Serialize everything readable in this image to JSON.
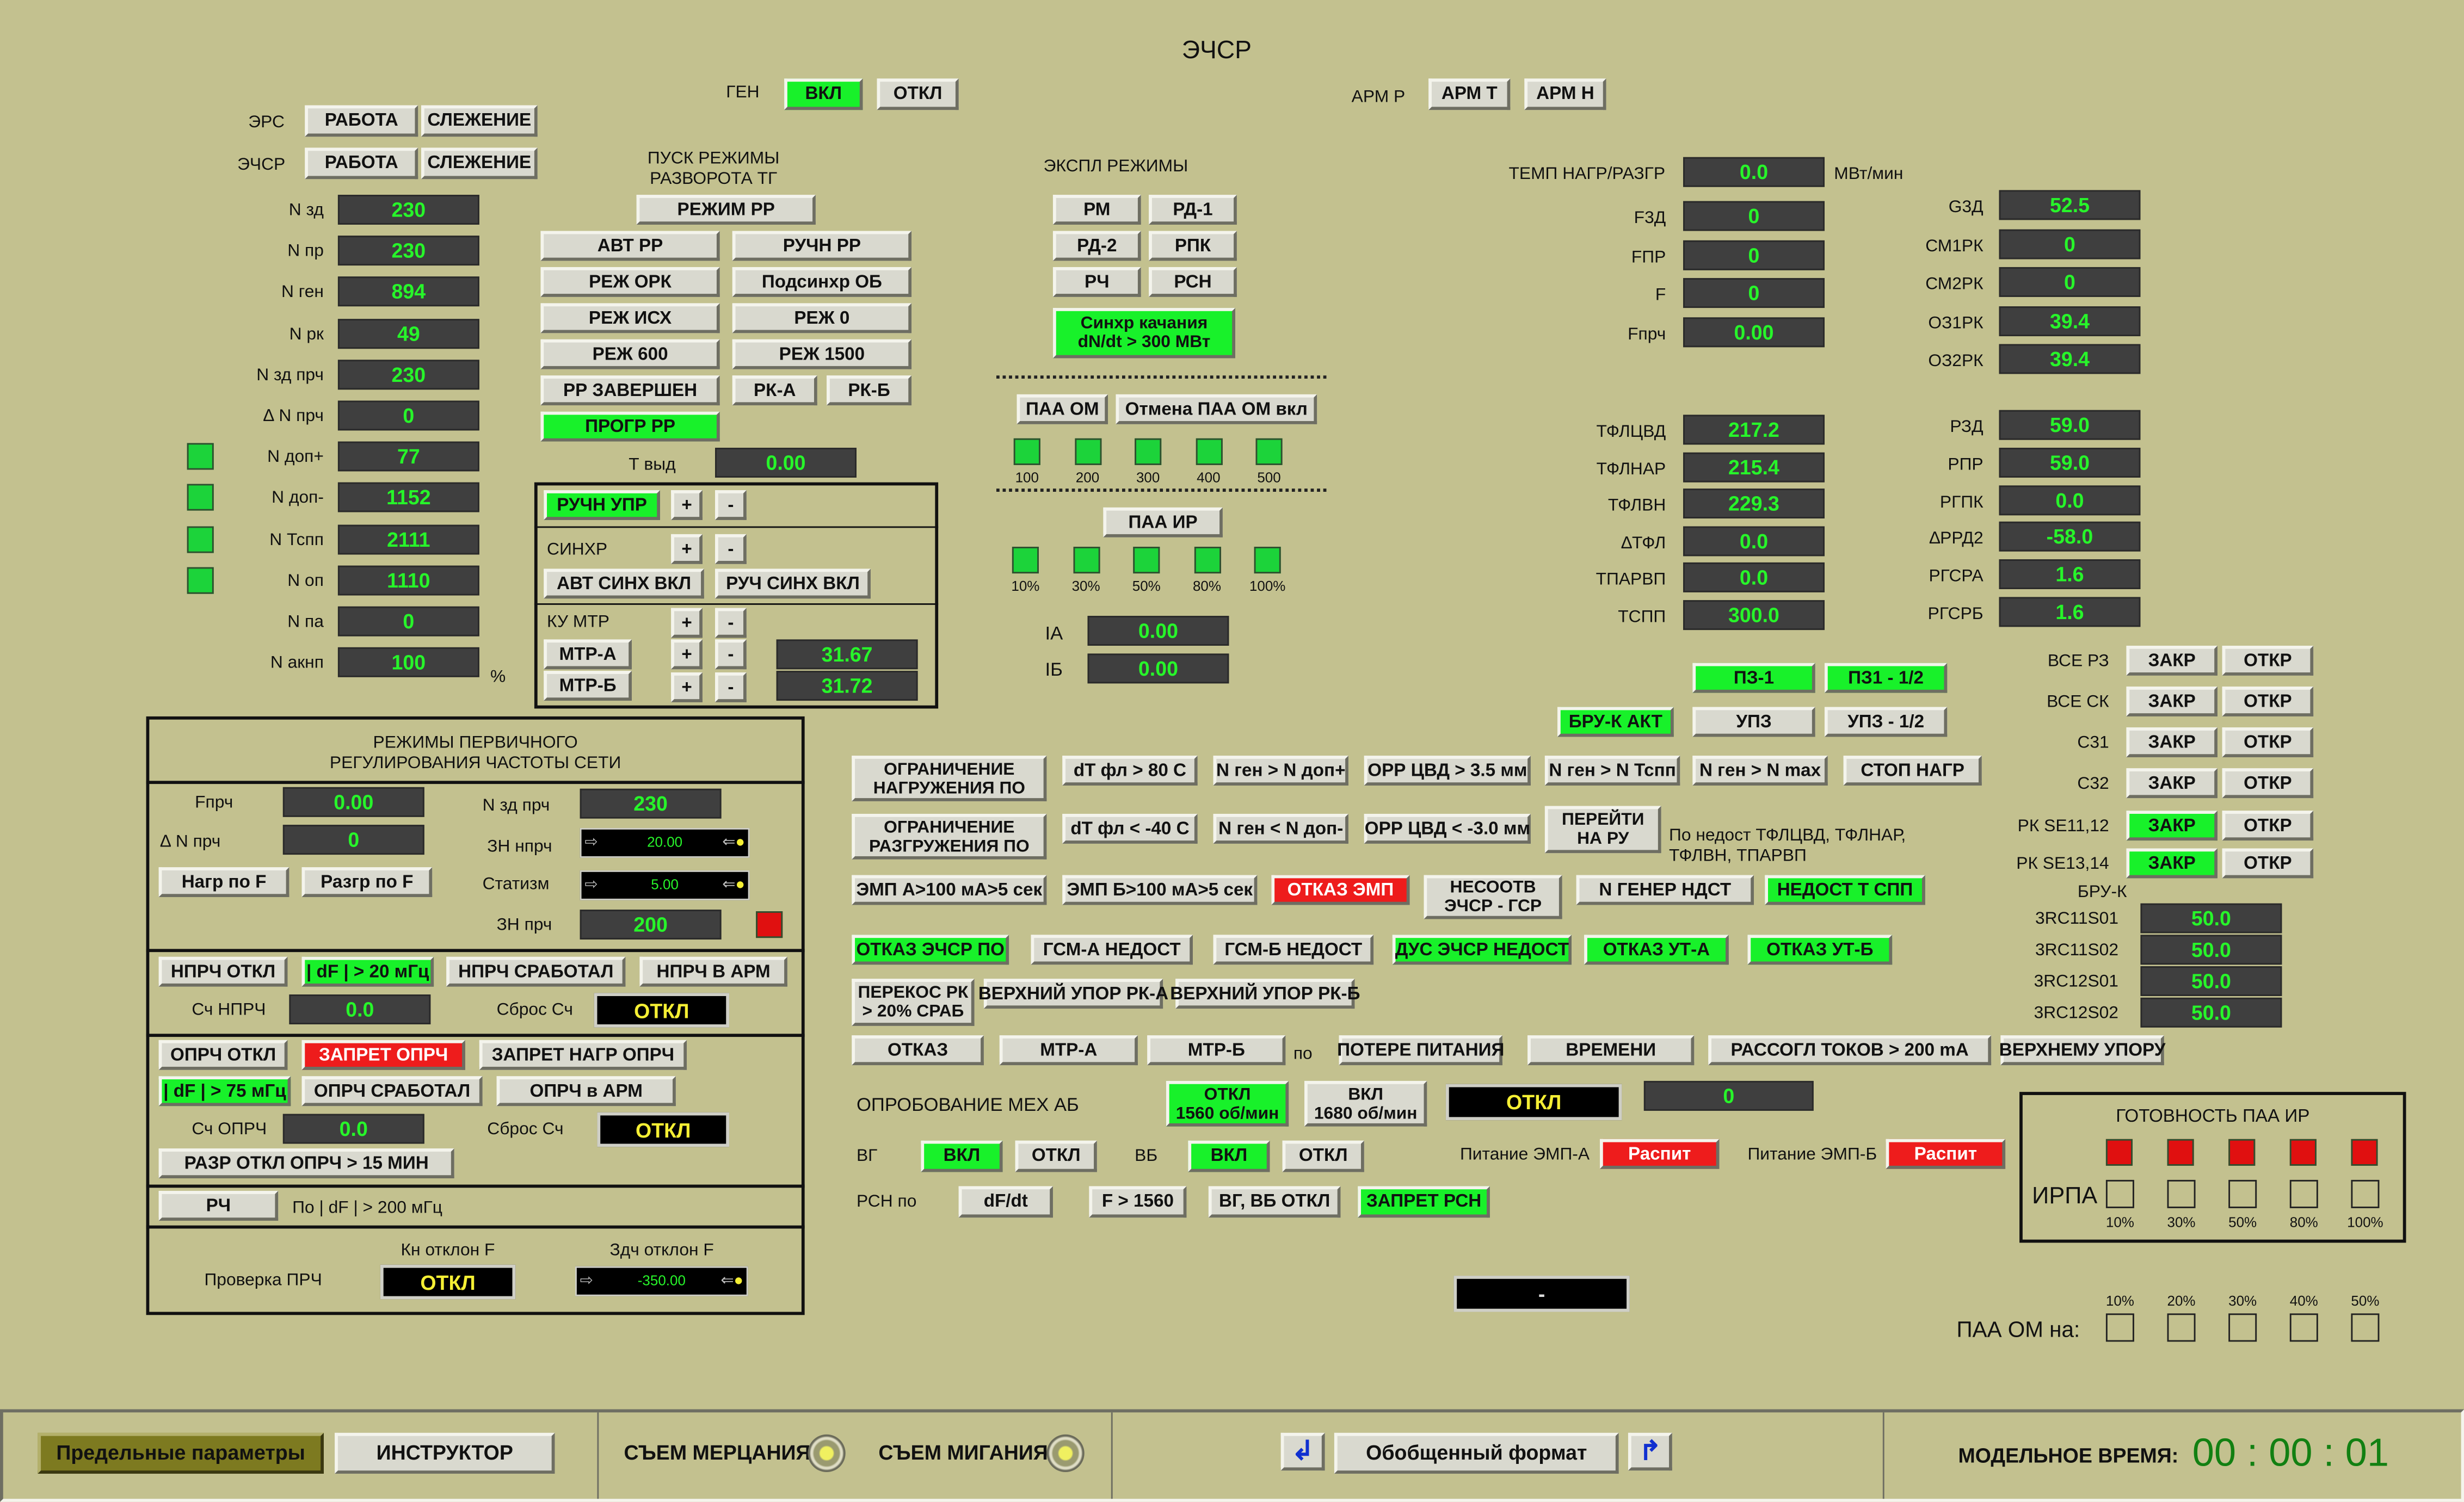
{
  "title": "ЭЧСР",
  "gen": {
    "label": "ГЕН",
    "on": "ВКЛ",
    "off": "ОТКЛ"
  },
  "arm": {
    "label": "АРМ Р",
    "t": "АРМ Т",
    "n": "АРМ Н"
  },
  "ers": {
    "label": "ЭРС",
    "work": "РАБОТА",
    "track": "СЛЕЖЕНИЕ"
  },
  "echsr": {
    "label": "ЭЧСР",
    "work": "РАБОТА",
    "track": "СЛЕЖЕНИЕ"
  },
  "params": [
    {
      "label": "N зд",
      "value": "230",
      "indicator": false
    },
    {
      "label": "N пр",
      "value": "230",
      "indicator": false
    },
    {
      "label": "N ген",
      "value": "894",
      "indicator": false
    },
    {
      "label": "N рк",
      "value": "49",
      "indicator": false
    },
    {
      "label": "N зд прч",
      "value": "230",
      "indicator": false
    },
    {
      "label": "∆ N прч",
      "value": "0",
      "indicator": false
    },
    {
      "label": "N доп+",
      "value": "77",
      "indicator": true
    },
    {
      "label": "N доп-",
      "value": "1152",
      "indicator": true
    },
    {
      "label": "N Тспп",
      "value": "2111",
      "indicator": true
    },
    {
      "label": "N оп",
      "value": "1110",
      "indicator": true
    },
    {
      "label": "N па",
      "value": "0",
      "indicator": false
    },
    {
      "label": "N акнп",
      "value": "100",
      "indicator": false
    }
  ],
  "percent": "%",
  "startup": {
    "title1": "ПУСК РЕЖИМЫ",
    "title2": "РАЗВОРОТА ТГ",
    "mode_rr": "РЕЖИМ РР",
    "avt_rr": "АВТ РР",
    "ruchn_rr": "РУЧН РР",
    "rezh_ork": "РЕЖ ОРК",
    "podsinhr": "Подсинхр ОБ",
    "rezh_ish": "РЕЖ ИСХ",
    "rezh0": "РЕЖ 0",
    "rezh600": "РЕЖ 600",
    "rezh1500": "РЕЖ 1500",
    "rr_done": "РР ЗАВЕРШЕН",
    "rka": "РК-А",
    "rkb": "РК-Б",
    "progr": "ПРОГР РР",
    "tvyd_label": "Т выд",
    "tvyd_value": "0.00"
  },
  "manual": {
    "ruchn": "РУЧН УПР",
    "plus": "+",
    "minus": "-",
    "sinhr": "СИНХР",
    "avt_sinh": "АВТ СИНХ ВКЛ",
    "ruch_sinh": "РУЧ СИНХ ВКЛ",
    "ku": "КУ МТР",
    "mtra": "МТР-А",
    "mtrb": "МТР-Б",
    "mtra_val": "31.67",
    "mtrb_val": "31.72"
  },
  "expl": {
    "title": "ЭКСПЛ РЕЖИМЫ",
    "rm": "РМ",
    "rd1": "РД-1",
    "rd2": "РД-2",
    "rpk": "РПК",
    "rch": "РЧ",
    "rsn": "РСН",
    "sinhr_kach1": "Синхр качания",
    "sinhr_kach2": "dN/dt > 300 МВт",
    "paa_om": "ПАА ОМ",
    "paa_cancel": "Отмена ПАА ОМ вкл",
    "om_levels": [
      "100",
      "200",
      "300",
      "400",
      "500"
    ],
    "paa_ir": "ПАА ИР",
    "ir_levels": [
      "10%",
      "30%",
      "50%",
      "80%",
      "100%"
    ],
    "ia": "IA",
    "ia_val": "0.00",
    "ib": "IБ",
    "ib_val": "0.00"
  },
  "temp": {
    "label": "ТЕМП НАГР/РАЗГР",
    "value": "0.0",
    "unit": "МВт/мин"
  },
  "freq": [
    {
      "label": "F3Д",
      "value": "0"
    },
    {
      "label": "FПР",
      "value": "0"
    },
    {
      "label": "F",
      "value": "0"
    },
    {
      "label": "Fпрч",
      "value": "0.00"
    }
  ],
  "g": [
    {
      "label": "G3Д",
      "value": "52.5"
    },
    {
      "label": "СМ1РК",
      "value": "0"
    },
    {
      "label": "СМ2РК",
      "value": "0"
    },
    {
      "label": "ОЗ1РК",
      "value": "39.4"
    },
    {
      "label": "ОЗ2РК",
      "value": "39.4"
    }
  ],
  "tfl": [
    {
      "label": "ТФЛЦВД",
      "value": "217.2"
    },
    {
      "label": "ТФЛНАР",
      "value": "215.4"
    },
    {
      "label": "ТФЛВН",
      "value": "229.3"
    },
    {
      "label": "∆ТФЛ",
      "value": "0.0"
    },
    {
      "label": "ТПАРВП",
      "value": "0.0"
    },
    {
      "label": "ТСПП",
      "value": "300.0"
    }
  ],
  "rzd": [
    {
      "label": "РЗД",
      "value": "59.0"
    },
    {
      "label": "РПР",
      "value": "59.0"
    },
    {
      "label": "РГПК",
      "value": "0.0"
    },
    {
      "label": "∆РРД2",
      "value": "-58.0"
    },
    {
      "label": "РГСРА",
      "value": "1.6"
    },
    {
      "label": "РГСРБ",
      "value": "1.6"
    }
  ],
  "pz": {
    "pz1": "ПЗ-1",
    "pz12": "ПЗ1 - 1/2",
    "bru_akt": "БРУ-К АКТ",
    "upz": "УПЗ",
    "upz12": "УПЗ - 1/2"
  },
  "valves": [
    {
      "label": "ВСЕ РЗ",
      "zak": "ЗАКР",
      "otk": "ОТКР",
      "g": false
    },
    {
      "label": "ВСЕ СК",
      "zak": "ЗАКР",
      "otk": "ОТКР",
      "g": false
    },
    {
      "label": "С31",
      "zak": "ЗАКР",
      "otk": "ОТКР",
      "g": false
    },
    {
      "label": "С32",
      "zak": "ЗАКР",
      "otk": "ОТКР",
      "g": false
    },
    {
      "label": "РК SE11,12",
      "zak": "ЗАКР",
      "otk": "ОТКР",
      "g": true
    },
    {
      "label": "РК SE13,14",
      "zak": "ЗАКР",
      "otk": "ОТКР",
      "g": true
    }
  ],
  "bruk": {
    "label": "БРУ-К",
    "items": [
      {
        "label": "3RC11S01",
        "value": "50.0"
      },
      {
        "label": "3RC11S02",
        "value": "50.0"
      },
      {
        "label": "3RC12S01",
        "value": "50.0"
      },
      {
        "label": "3RC12S02",
        "value": "50.0"
      }
    ]
  },
  "limits": {
    "ogr_nagr1": "ОГРАНИЧЕНИЕ",
    "ogr_nagr2": "НАГРУЖЕНИЯ ПО",
    "dtfl80": "dT фл > 80 С",
    "ngen_dop": "N ген > N доп+",
    "orr35": "ОРР ЦВД > 3.5 мм",
    "ngen_tspp": "N ген > N Тспп",
    "ngen_max": "N ген > N max",
    "stop": "СТОП НАГР",
    "ogr_razgr1": "ОГРАНИЧЕНИЕ",
    "ogr_razgr2": "РАЗГРУЖЕНИЯ ПО",
    "dtfl40": "dT фл < -40 С",
    "ngen_dopm": "N ген < N доп-",
    "orr30": "ОРР ЦВД < -3.0 мм",
    "pereiti1": "ПЕРЕЙТИ",
    "pereiti2": "НА РУ",
    "nedost_txt1": "По недост ТФЛЦВД, ТФЛНАР,",
    "nedost_txt2": "ТФЛВН, ТПАРВП"
  },
  "emp": {
    "a": "ЭМП А>100 мА>5 сек",
    "b": "ЭМП Б>100 мА>5 сек",
    "otkaz": "ОТКАЗ ЭМП",
    "nesoot1": "НЕСООТВ",
    "nesoot2": "ЭЧСР - ГСР",
    "ngen_ndst": "N ГЕНЕР НДСТ",
    "nedost_tspp": "НЕДОСТ Т СПП"
  },
  "faults": {
    "otkaz_echsr": "ОТКАЗ ЭЧСР ПО",
    "gsma": "ГСМ-А НЕДОСТ",
    "gsmb": "ГСМ-Б НЕДОСТ",
    "dus": "ДУС ЭЧСР НЕДОСТ",
    "utA": "ОТКАЗ УТ-А",
    "utB": "ОТКАЗ УТ-Б",
    "perekos1": "ПЕРЕКОС РК",
    "perekos2": "> 20% СРАБ",
    "upor_a": "ВЕРХНИЙ УПОР РК-А",
    "upor_b": "ВЕРХНИЙ УПОР РК-Б"
  },
  "otkaz_row": {
    "otkaz": "ОТКАЗ",
    "mtra": "МТР-А",
    "mtrb": "МТР-Б",
    "po": "по",
    "poteri": "ПОТЕРЕ ПИТАНИЯ",
    "vremeni": "ВРЕМЕНИ",
    "rassogl": "РАССОГЛ ТОКОВ > 200 mA",
    "verh": "ВЕРХНЕМУ УПОРУ"
  },
  "oprob": {
    "label": "ОПРОБОВАНИЕ МЕХ АБ",
    "otkl1": "ОТКЛ",
    "otkl2": "1560 об/мин",
    "vkl1": "ВКЛ",
    "vkl2": "1680 об/мин",
    "state": "ОТКЛ",
    "value": "0"
  },
  "vg": {
    "label": "ВГ",
    "on": "ВКЛ",
    "off": "ОТКЛ"
  },
  "vb": {
    "label": "ВБ",
    "on": "ВКЛ",
    "off": "ОТКЛ"
  },
  "pit_a": {
    "label": "Питание ЭМП-А",
    "state": "Распит"
  },
  "pit_b": {
    "label": "Питание ЭМП-Б",
    "state": "Распит"
  },
  "rsn": {
    "label": "РСН по",
    "dfdt": "dF/dt",
    "f1560": "F > 1560",
    "vgvb": "ВГ, ВБ ОТКЛ",
    "zapret": "ЗАПРЕТ РСН"
  },
  "dash": "-",
  "gotovnost": {
    "title": "ГОТОВНОСТЬ ПАА ИР",
    "irpa": "ИРПА",
    "levels": [
      "10%",
      "30%",
      "50%",
      "80%",
      "100%"
    ]
  },
  "paa_om_na": {
    "label": "ПАА ОМ на:",
    "levels": [
      "10%",
      "20%",
      "30%",
      "40%",
      "50%"
    ]
  },
  "prim": {
    "title1": "РЕЖИМЫ ПЕРВИЧНОГО",
    "title2": "РЕГУЛИРОВАНИЯ ЧАСТОТЫ СЕТИ",
    "fprch": "Fпрч",
    "fprch_val": "0.00",
    "dnprch": "∆ N прч",
    "dnprch_val": "0",
    "nzd": "N зд прч",
    "nzd_val": "230",
    "zn_nprch": "ЗН нпрч",
    "zn_nprch_val": "20.00",
    "statizm": "Статизм",
    "statizm_val": "5.00",
    "zn_prch": "ЗН прч",
    "zn_prch_val": "200",
    "nagr_f": "Нагр по F",
    "razgr_f": "Разгр по F",
    "nprch_otkl": "НПРЧ ОТКЛ",
    "df20": "| dF | > 20 мГц",
    "nprch_srab": "НПРЧ СРАБОТАЛ",
    "nprch_arm": "НПРЧ В АРМ",
    "sch_nprch": "Сч НПРЧ",
    "sch_nprch_val": "0.0",
    "sbros1": "Сброс Сч",
    "sbros1_state": "ОТКЛ",
    "oprch_otkl": "ОПРЧ ОТКЛ",
    "zapret_oprch": "ЗАПРЕТ ОПРЧ",
    "zapret_nagr": "ЗАПРЕТ НАГР ОПРЧ",
    "df75": "| dF | > 75 мГц",
    "oprch_srab": "ОПРЧ СРАБОТАЛ",
    "oprch_arm": "ОПРЧ в АРМ",
    "sch_oprch": "Сч ОПРЧ",
    "sch_oprch_val": "0.0",
    "sbros2": "Сброс Сч",
    "sbros2_state": "ОТКЛ",
    "razr": "РАЗР ОТКЛ ОПРЧ > 15 МИН",
    "rch": "РЧ",
    "po_df": "По | dF | > 200 мГц",
    "kn": "Кн отклон F",
    "zdch": "Здч отклон F",
    "proverka": "Проверка ПРЧ",
    "proverka_state": "ОТКЛ",
    "zdch_val": "-350.00"
  },
  "footer": {
    "limits": "Предельные параметры",
    "instructor": "ИНСТРУКТОР",
    "sem_merc": "СЪЕМ МЕРЦАНИЯ",
    "sem_mig": "СЪЕМ МИГАНИЯ",
    "obobsh": "Обобщенный формат",
    "model_label": "МОДЕЛЬНОЕ ВРЕМЯ:",
    "model_time": "00 : 00 : 01"
  },
  "colors": {
    "bg": "#c3c18f",
    "green": "#18f12a",
    "red": "#ee1c1c",
    "value_bg": "#3f3f3f",
    "value_fg": "#27f52a"
  }
}
